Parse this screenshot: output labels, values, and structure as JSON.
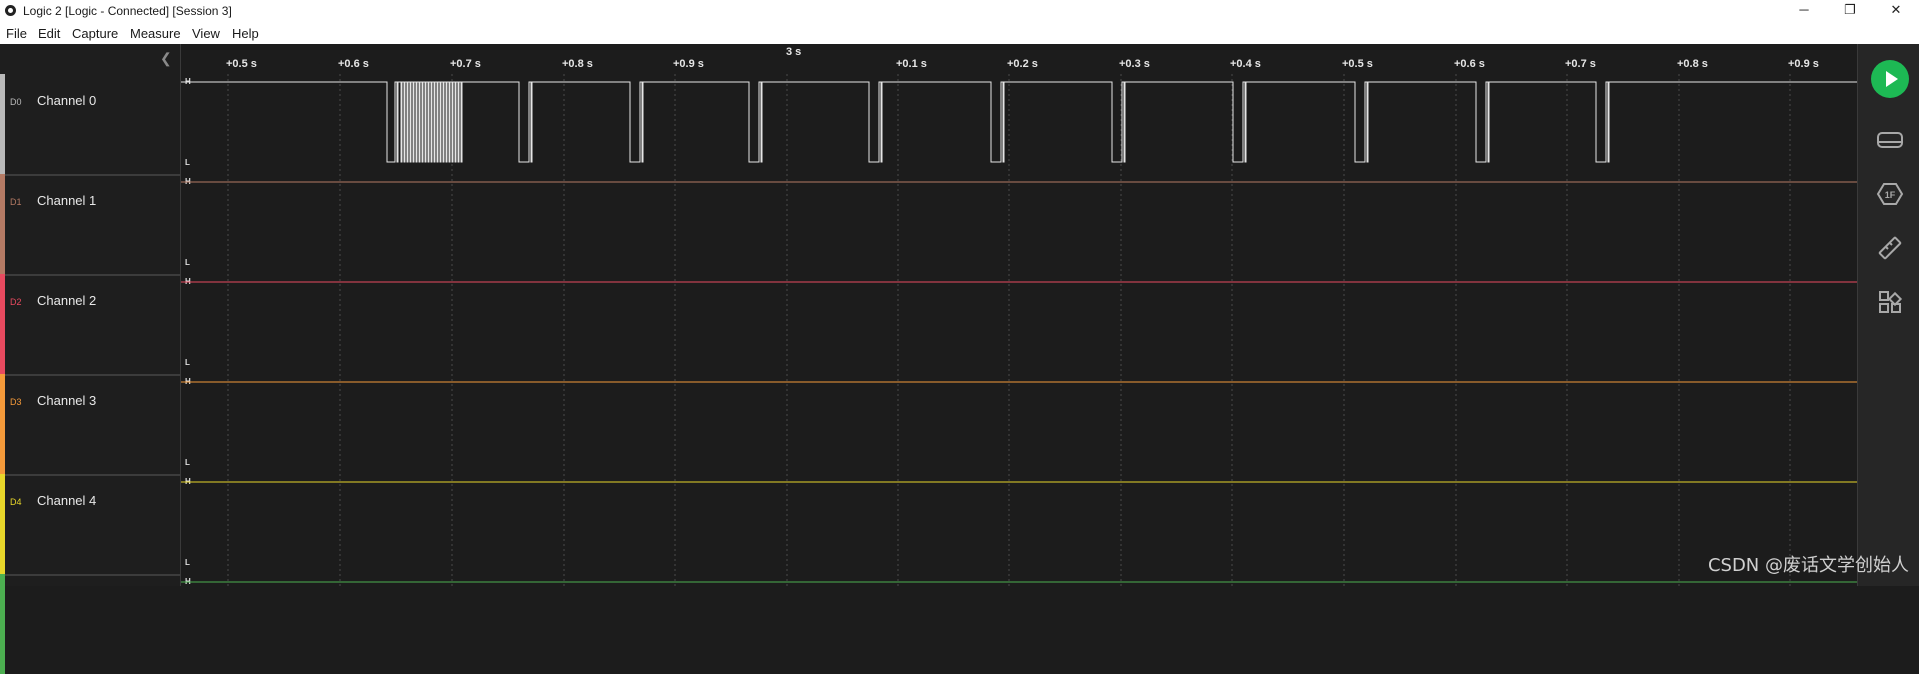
{
  "window": {
    "title": "Logic 2 [Logic - Connected] [Session 3]",
    "minimize": "─",
    "maximize": "❐",
    "close": "✕"
  },
  "menu": [
    "File",
    "Edit",
    "Capture",
    "Measure",
    "View",
    "Help"
  ],
  "ruler": {
    "center_label": "3 s",
    "ticks": [
      "+0.5 s",
      "+0.6 s",
      "+0.7 s",
      "+0.8 s",
      "+0.9 s",
      "+0.1 s",
      "+0.2 s",
      "+0.3 s",
      "+0.4 s",
      "+0.5 s",
      "+0.6 s",
      "+0.7 s",
      "+0.8 s",
      "+0.9 s"
    ]
  },
  "channels": [
    {
      "id": "D0",
      "name": "Channel 0",
      "color": "#b9b9b9",
      "high": "H",
      "low": "L"
    },
    {
      "id": "D1",
      "name": "Channel 1",
      "color": "#b47a64",
      "high": "H",
      "low": "L"
    },
    {
      "id": "D2",
      "name": "Channel 2",
      "color": "#e84a5f",
      "high": "H",
      "low": "L"
    },
    {
      "id": "D3",
      "name": "Channel 3",
      "color": "#f59a3a",
      "high": "H",
      "low": "L"
    },
    {
      "id": "D4",
      "name": "Channel 4",
      "color": "#e8d62a",
      "high": "H",
      "low": "L"
    },
    {
      "id": "D5",
      "high": "H",
      "color": "#4caf50"
    }
  ],
  "right_toolbar": {
    "icons": [
      "play-icon",
      "device-icon",
      "analyzer-icon",
      "measure-icon",
      "extensions-icon"
    ],
    "accent": "#1db954"
  },
  "watermark": "CSDN @废话文学创始人"
}
